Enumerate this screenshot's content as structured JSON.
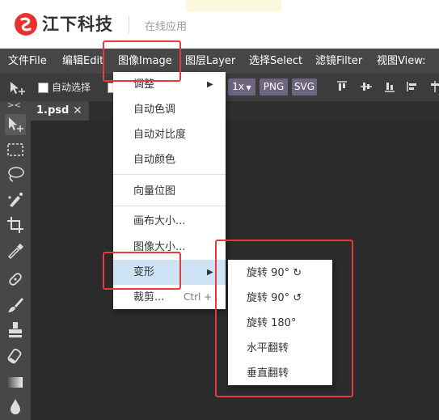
{
  "header": {
    "brand": "江下科技",
    "subtitle": "在线应用",
    "brand_color": "#e8322f"
  },
  "menubar": {
    "items": [
      "文件File",
      "编辑Edit",
      "图像Image",
      "图层Layer",
      "选择Select",
      "滤镜Filter",
      "视图View:"
    ]
  },
  "options": {
    "auto_select": "自动选择",
    "zoom": "1x",
    "png": "PNG",
    "svg": "SVG"
  },
  "tab": {
    "name": "1.psd",
    "close": "✕"
  },
  "toolbar": {
    "collapse": "><",
    "tools": [
      "move-tool",
      "marquee-tool",
      "lasso-tool",
      "quick-select-tool",
      "crop-tool",
      "eyedropper-tool",
      "healing-brush-tool",
      "brush-tool",
      "stamp-tool",
      "eraser-tool",
      "gradient-tool",
      "blur-tool"
    ]
  },
  "image_menu": {
    "adjust": "调整",
    "auto_tone": "自动色调",
    "auto_contrast": "自动对比度",
    "auto_color": "自动颜色",
    "vector_bitmap": "向量位图",
    "canvas_size": "画布大小...",
    "image_size": "图像大小...",
    "transform": "变形",
    "crop": "裁剪...",
    "crop_shortcut": "Ctrl + ."
  },
  "transform_submenu": {
    "items": [
      "旋转 90° ↻",
      "旋转 90° ↺",
      "旋转 180°",
      "水平翻转",
      "垂直翻转"
    ]
  },
  "colors": {
    "menubar_bg": "#474747",
    "highlight": "#cfe3f6",
    "annotation": "#e53b3b",
    "pill": "#6e6681"
  }
}
